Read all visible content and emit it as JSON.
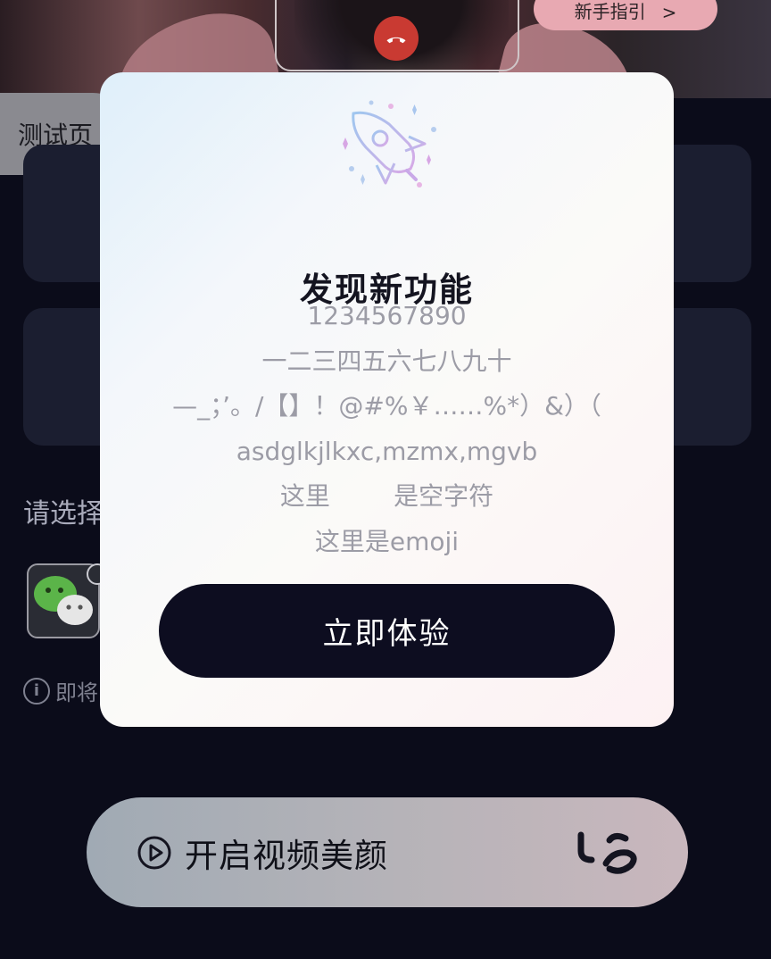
{
  "background": {
    "guide_pill": {
      "label": "新手指引",
      "chevron": ">"
    },
    "test_pill": {
      "label": "测试页"
    },
    "select_label": "请选择",
    "info_text": "即将",
    "bottom_bar": {
      "label": "开启视频美颜",
      "play_icon": "play-circle-icon",
      "face_icon": "face-icon"
    }
  },
  "modal": {
    "icon": "rocket-icon",
    "title": "发现新功能",
    "lines": [
      "1234567890",
      "一二三四五六七八九十",
      "—_；’。/【】！@#%￥……%*）&）（",
      "asdglkjlkxc,mzmx,mgvb",
      "这里        是空字符",
      "这里是emoji"
    ],
    "cta_label": "立即体验"
  },
  "colors": {
    "page_bg": "#0b0c1a",
    "cta_bg": "#0d0d20",
    "hangup": "#c93a32",
    "body_text": "#9c9ca6"
  }
}
